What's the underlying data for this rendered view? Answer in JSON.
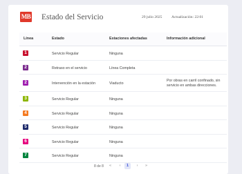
{
  "header": {
    "logo_text": "MB",
    "title": "Estado del Servicio",
    "date": "29 julio 2025",
    "updated": "Actualización: 22:01"
  },
  "table": {
    "columns": [
      "Línea",
      "Estado",
      "Estaciones afectadas",
      "Información adicional"
    ],
    "rows": [
      {
        "line": "1",
        "color": "#c8102e",
        "status": "Servicio Regular",
        "stations": "Ninguna",
        "info": ""
      },
      {
        "line": "2",
        "color": "#7b2c8e",
        "status": "Retraso en el servicio",
        "stations": "Línea Completa",
        "info": ""
      },
      {
        "line": "2",
        "color": "#a020b0",
        "status": "Intervención en la estación",
        "stations": "Viaducto",
        "info": "Por obras en carril confinado, sin servicio en ambas direcciones."
      },
      {
        "line": "3",
        "color": "#8db600",
        "status": "Servicio Regular",
        "stations": "Ninguna",
        "info": ""
      },
      {
        "line": "4",
        "color": "#f47920",
        "status": "Servicio Regular",
        "stations": "Ninguna",
        "info": ""
      },
      {
        "line": "5",
        "color": "#1d2a6b",
        "status": "Servicio Regular",
        "stations": "Ninguna",
        "info": ""
      },
      {
        "line": "6",
        "color": "#e6007e",
        "status": "Servicio Regular",
        "stations": "Ninguna",
        "info": ""
      },
      {
        "line": "7",
        "color": "#00843d",
        "status": "Servicio Regular",
        "stations": "Ninguna",
        "info": ""
      }
    ]
  },
  "pager": {
    "range_text": "8 de 8",
    "first": "«",
    "prev": "‹",
    "current": "1",
    "next": "›",
    "last": "»"
  }
}
